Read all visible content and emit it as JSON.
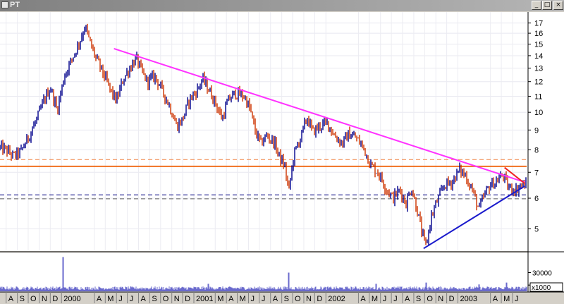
{
  "window": {
    "title": "PT",
    "minimize_glyph": "_",
    "maximize_glyph": "□",
    "close_glyph": "×"
  },
  "chart_data": {
    "type": "line",
    "title": "",
    "price_axis": {
      "scale": "log",
      "range": [
        4.4,
        18.0
      ],
      "ticks": [
        17,
        16,
        15,
        14,
        13,
        12,
        11,
        10,
        9,
        8,
        7,
        6,
        5
      ]
    },
    "volume_axis": {
      "range": [
        0,
        60000
      ],
      "ticks": [
        30000,
        10000
      ],
      "unit_label": "x1000"
    },
    "x_axis": {
      "range": [
        "1999-07-15",
        "2003-07-10"
      ],
      "labels": [
        {
          "t": "A",
          "d": "1999-08-01"
        },
        {
          "t": "S",
          "d": "1999-09-01"
        },
        {
          "t": "O",
          "d": "1999-10-01"
        },
        {
          "t": "N",
          "d": "1999-11-01"
        },
        {
          "t": "D",
          "d": "1999-12-01"
        },
        {
          "t": "2000",
          "d": "2000-01-01"
        },
        {
          "t": "A",
          "d": "2000-04-01"
        },
        {
          "t": "M",
          "d": "2000-05-01"
        },
        {
          "t": "J",
          "d": "2000-06-01"
        },
        {
          "t": "J",
          "d": "2000-07-01"
        },
        {
          "t": "A",
          "d": "2000-08-01"
        },
        {
          "t": "S",
          "d": "2000-09-01"
        },
        {
          "t": "O",
          "d": "2000-10-01"
        },
        {
          "t": "N",
          "d": "2000-11-01"
        },
        {
          "t": "D",
          "d": "2000-12-01"
        },
        {
          "t": "2001",
          "d": "2001-01-01"
        },
        {
          "t": "M",
          "d": "2001-03-01"
        },
        {
          "t": "A",
          "d": "2001-04-01"
        },
        {
          "t": "M",
          "d": "2001-05-01"
        },
        {
          "t": "J",
          "d": "2001-06-01"
        },
        {
          "t": "J",
          "d": "2001-07-01"
        },
        {
          "t": "A",
          "d": "2001-08-01"
        },
        {
          "t": "S",
          "d": "2001-09-01"
        },
        {
          "t": "O",
          "d": "2001-10-01"
        },
        {
          "t": "N",
          "d": "2001-11-01"
        },
        {
          "t": "D",
          "d": "2001-12-01"
        },
        {
          "t": "2002",
          "d": "2002-01-01"
        },
        {
          "t": "A",
          "d": "2002-04-01"
        },
        {
          "t": "M",
          "d": "2002-05-01"
        },
        {
          "t": "J",
          "d": "2002-06-01"
        },
        {
          "t": "J",
          "d": "2002-07-01"
        },
        {
          "t": "A",
          "d": "2002-08-01"
        },
        {
          "t": "S",
          "d": "2002-09-01"
        },
        {
          "t": "O",
          "d": "2002-10-01"
        },
        {
          "t": "N",
          "d": "2002-11-01"
        },
        {
          "t": "D",
          "d": "2002-12-01"
        },
        {
          "t": "2003",
          "d": "2003-01-01"
        },
        {
          "t": "A",
          "d": "2003-04-01"
        },
        {
          "t": "M",
          "d": "2003-05-01"
        },
        {
          "t": "J",
          "d": "2003-06-01"
        }
      ]
    },
    "price_series": {
      "colors": {
        "up": "#00008b",
        "down": "#cc3300"
      },
      "points": [
        [
          "1999-07-15",
          8.1
        ],
        [
          "1999-08-01",
          8.0
        ],
        [
          "1999-08-20",
          7.7
        ],
        [
          "1999-09-10",
          7.9
        ],
        [
          "1999-10-01",
          8.6
        ],
        [
          "1999-10-25",
          9.6
        ],
        [
          "1999-11-15",
          10.8
        ],
        [
          "1999-12-01",
          11.6
        ],
        [
          "1999-12-20",
          10.1
        ],
        [
          "2000-01-10",
          12.5
        ],
        [
          "2000-01-31",
          13.8
        ],
        [
          "2000-02-20",
          15.2
        ],
        [
          "2000-03-06",
          16.7
        ],
        [
          "2000-03-20",
          15.1
        ],
        [
          "2000-04-05",
          13.8
        ],
        [
          "2000-04-25",
          12.6
        ],
        [
          "2000-05-15",
          11.4
        ],
        [
          "2000-06-01",
          10.7
        ],
        [
          "2000-06-20",
          12.2
        ],
        [
          "2000-07-10",
          13.1
        ],
        [
          "2000-07-25",
          13.8
        ],
        [
          "2000-08-10",
          12.7
        ],
        [
          "2000-08-25",
          12.0
        ],
        [
          "2000-09-15",
          12.4
        ],
        [
          "2000-10-05",
          11.4
        ],
        [
          "2000-10-25",
          10.4
        ],
        [
          "2000-11-15",
          9.2
        ],
        [
          "2000-12-01",
          9.6
        ],
        [
          "2000-12-20",
          10.8
        ],
        [
          "2001-01-10",
          11.4
        ],
        [
          "2001-01-25",
          12.2
        ],
        [
          "2001-02-10",
          11.5
        ],
        [
          "2001-03-01",
          10.6
        ],
        [
          "2001-03-20",
          9.6
        ],
        [
          "2001-04-05",
          10.7
        ],
        [
          "2001-04-25",
          11.2
        ],
        [
          "2001-05-20",
          11.0
        ],
        [
          "2001-06-05",
          10.2
        ],
        [
          "2001-06-20",
          8.9
        ],
        [
          "2001-07-05",
          8.3
        ],
        [
          "2001-07-20",
          8.7
        ],
        [
          "2001-08-10",
          8.4
        ],
        [
          "2001-08-25",
          7.7
        ],
        [
          "2001-09-10",
          7.2
        ],
        [
          "2001-09-20",
          6.2
        ],
        [
          "2001-10-05",
          7.8
        ],
        [
          "2001-10-25",
          8.7
        ],
        [
          "2001-11-10",
          9.7
        ],
        [
          "2001-11-25",
          8.9
        ],
        [
          "2001-12-15",
          9.2
        ],
        [
          "2002-01-05",
          9.4
        ],
        [
          "2002-01-25",
          8.7
        ],
        [
          "2002-02-15",
          8.3
        ],
        [
          "2002-03-05",
          8.8
        ],
        [
          "2002-03-25",
          8.6
        ],
        [
          "2002-04-15",
          8.1
        ],
        [
          "2002-05-05",
          7.3
        ],
        [
          "2002-05-25",
          7.0
        ],
        [
          "2002-06-15",
          6.4
        ],
        [
          "2002-07-05",
          6.0
        ],
        [
          "2002-07-25",
          6.3
        ],
        [
          "2002-08-10",
          5.8
        ],
        [
          "2002-08-25",
          6.4
        ],
        [
          "2002-09-10",
          5.6
        ],
        [
          "2002-09-25",
          4.8
        ],
        [
          "2002-10-05",
          4.5
        ],
        [
          "2002-10-20",
          5.4
        ],
        [
          "2002-11-05",
          5.9
        ],
        [
          "2002-11-25",
          6.5
        ],
        [
          "2002-12-15",
          6.6
        ],
        [
          "2003-01-05",
          7.1
        ],
        [
          "2003-01-20",
          6.9
        ],
        [
          "2003-02-10",
          6.3
        ],
        [
          "2003-02-28",
          5.6
        ],
        [
          "2003-03-15",
          6.1
        ],
        [
          "2003-03-31",
          6.5
        ],
        [
          "2003-04-15",
          6.6
        ],
        [
          "2003-05-05",
          6.9
        ],
        [
          "2003-05-20",
          6.4
        ],
        [
          "2003-06-10",
          6.3
        ],
        [
          "2003-06-25",
          6.5
        ]
      ]
    },
    "volume_series": {
      "color": "#6a6acd",
      "base": 6000,
      "spikes": [
        {
          "d": "2000-01-05",
          "v": 55000
        },
        {
          "d": "2001-09-20",
          "v": 30000
        },
        {
          "d": "2002-05-20",
          "v": 12000
        },
        {
          "d": "2001-02-10",
          "v": 12000
        },
        {
          "d": "2002-10-05",
          "v": 14000
        },
        {
          "d": "2003-02-28",
          "v": 11000
        },
        {
          "d": "2003-05-15",
          "v": 14000
        }
      ]
    },
    "trendlines": [
      {
        "name": "resistance",
        "color": "#ff33ff",
        "from": [
          "2000-05-25",
          14.6
        ],
        "to": [
          "2003-07-05",
          6.6
        ]
      },
      {
        "name": "support",
        "color": "#1a1acc",
        "from": [
          "2002-09-28",
          4.45
        ],
        "to": [
          "2003-07-05",
          6.45
        ]
      },
      {
        "name": "short",
        "color": "#ee2222",
        "from": [
          "2003-05-10",
          7.2
        ],
        "to": [
          "2003-07-05",
          6.55
        ]
      }
    ],
    "horizontal_lines": [
      {
        "y": 7.55,
        "color": "#f08040",
        "style": "dashed"
      },
      {
        "y": 7.25,
        "color": "#f07020",
        "style": "solid"
      },
      {
        "y": 6.12,
        "color": "#000080",
        "style": "dashed"
      },
      {
        "y": 5.98,
        "color": "#606060",
        "style": "dashed"
      }
    ],
    "grid": true,
    "legend": "none"
  }
}
